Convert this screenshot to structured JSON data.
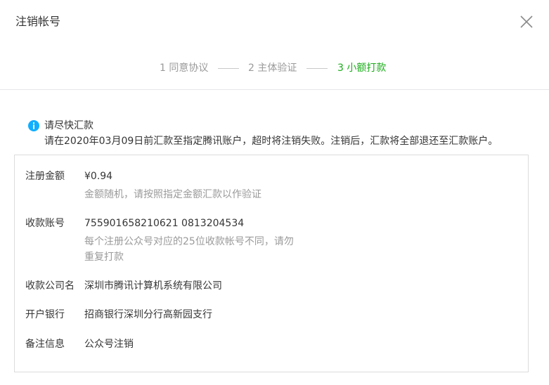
{
  "dialog": {
    "title": "注销帐号",
    "close_icon": "close-icon"
  },
  "steps": [
    {
      "label": "1 同意协议",
      "state": "done"
    },
    {
      "label": "2 主体验证",
      "state": "done"
    },
    {
      "label": "3 小额打款",
      "state": "active"
    }
  ],
  "colors": {
    "active_step": "#1aad19",
    "info_icon": "#10aeff",
    "muted_text": "#9a9a9a"
  },
  "notice": {
    "icon": "info-icon",
    "title": "请尽快汇款",
    "description": "请在2020年03月09日前汇款至指定腾讯账户，超时将注销失败。注销后，汇款将全部退还至汇款账户。"
  },
  "details": {
    "amount": {
      "label": "注册金额",
      "value": "¥0.94",
      "tip": "金额随机，请按照指定金额汇款以作验证"
    },
    "account": {
      "label": "收款账号",
      "value": "755901658210621 0813204534",
      "tip_line1": "每个注册公众号对应的25位收款帐号不同，请勿",
      "tip_line2": "重复打款"
    },
    "company": {
      "label": "收款公司名",
      "value": "深圳市腾讯计算机系统有限公司"
    },
    "bank": {
      "label": "开户银行",
      "value": "招商银行深圳分行高新园支行"
    },
    "remark": {
      "label": "备注信息",
      "value": "公众号注销"
    }
  }
}
